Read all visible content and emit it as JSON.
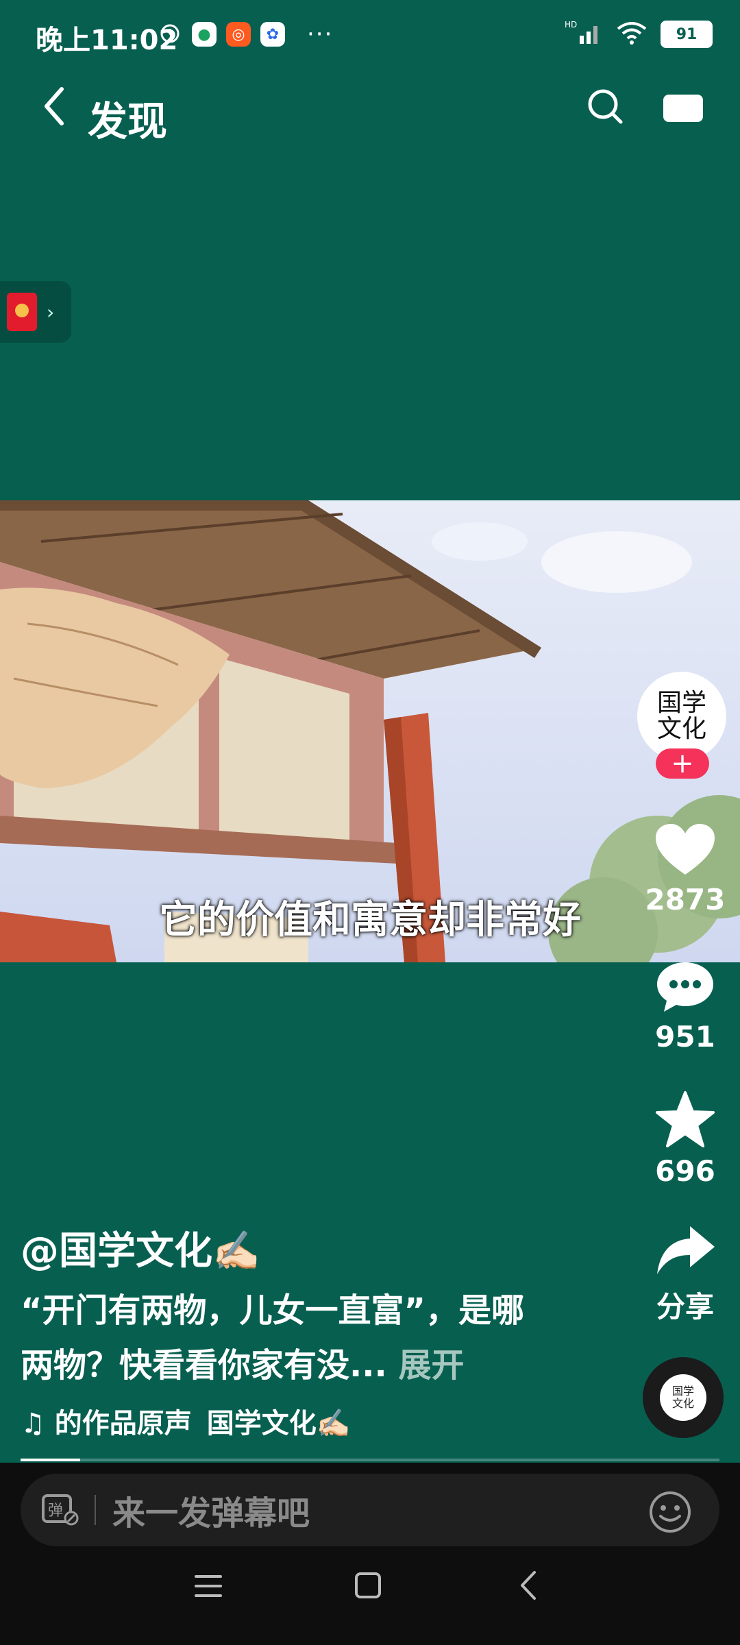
{
  "status_bar": {
    "time": "晚上11:02",
    "battery": "91",
    "more_dots": "···"
  },
  "header": {
    "title": "发现"
  },
  "video": {
    "subtitle": "它的价值和寓意却非常好"
  },
  "actions": {
    "likes": "2873",
    "comments": "951",
    "favorites": "696",
    "share_label": "分享",
    "follow_label": "+"
  },
  "avatar_text": "国学文化",
  "post": {
    "author": "@国学文化✍🏻",
    "description": "“开门有两物，儿女一直富”，是哪两物？快看看你家有没...",
    "expand_label": "展开",
    "music_prefix": "♫ 的作品原声",
    "music_author": "国学文化✍🏻",
    "progress": 0.085
  },
  "bottom": {
    "danmu_placeholder": "来一发弹幕吧"
  },
  "colors": {
    "background": "#075f50",
    "follow": "#f4325a",
    "envelope": "#e21c2c"
  }
}
